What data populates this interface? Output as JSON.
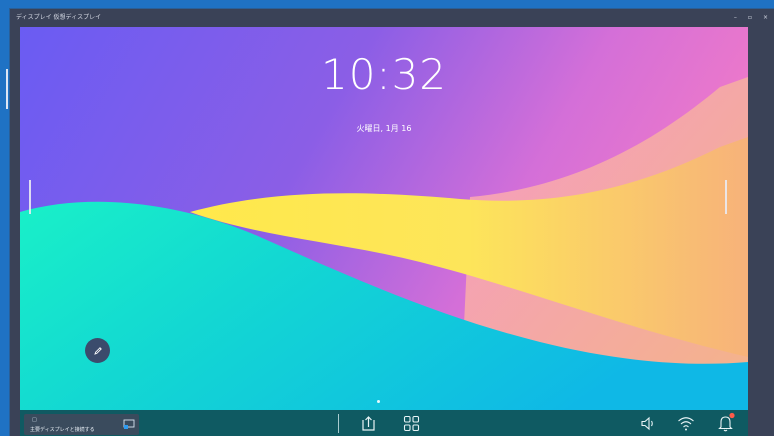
{
  "window": {
    "title": "ディスプレイ 仮想ディスプレイ",
    "controls": [
      "–",
      "▫",
      "×"
    ]
  },
  "status_icons": [
    "download-icon",
    "network-icon",
    "share-icon"
  ],
  "lockscreen": {
    "time": "10:32",
    "date": "火曜日, 1月 16"
  },
  "taskbar": {
    "cast_small_label": "□",
    "cast_label": "主要ディスプレイと接続する",
    "icons": [
      "upload-icon",
      "apps-grid-icon",
      "volume-icon",
      "wifi-icon",
      "bell-icon"
    ],
    "notification_dot_color": "#ff5b4a"
  },
  "colors": {
    "accent": "#1f72c4",
    "taskbar": "#0f5a62",
    "window_frame": "#3a4257"
  }
}
